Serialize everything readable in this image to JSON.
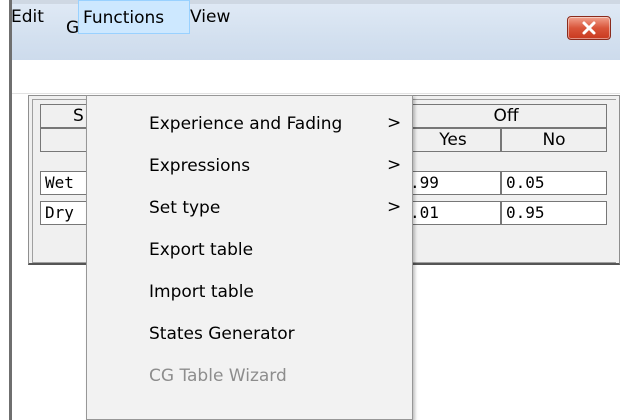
{
  "window": {
    "title": "Grass"
  },
  "menubar": {
    "items": [
      "Edit",
      "Functions",
      "View"
    ]
  },
  "table": {
    "header_left_partial": "S",
    "group_header": "Off",
    "columns": [
      "Yes",
      "No"
    ],
    "rows": [
      {
        "label_partial": "Wet",
        "yes": ".99",
        "no": "0.05"
      },
      {
        "label_partial": "Dry",
        "yes": ".01",
        "no": "0.95"
      }
    ]
  },
  "functions_menu": {
    "items": [
      {
        "label": "Experience and Fading",
        "submenu": true,
        "enabled": true
      },
      {
        "label": "Expressions",
        "submenu": true,
        "enabled": true
      },
      {
        "label": "Set type",
        "submenu": true,
        "enabled": true
      },
      {
        "label": "Export table",
        "submenu": false,
        "enabled": true
      },
      {
        "label": "Import table",
        "submenu": false,
        "enabled": true
      },
      {
        "label": "States Generator",
        "submenu": false,
        "enabled": true
      },
      {
        "label": "CG Table Wizard",
        "submenu": false,
        "enabled": false
      }
    ],
    "submenu_glyph": ">"
  },
  "icons": {
    "close": "close-icon",
    "submenu": "chevron-right-icon"
  },
  "colors": {
    "menu_highlight": "#cde8ff",
    "close_button": "#d9553a",
    "disabled_text": "#8d8d8d"
  }
}
